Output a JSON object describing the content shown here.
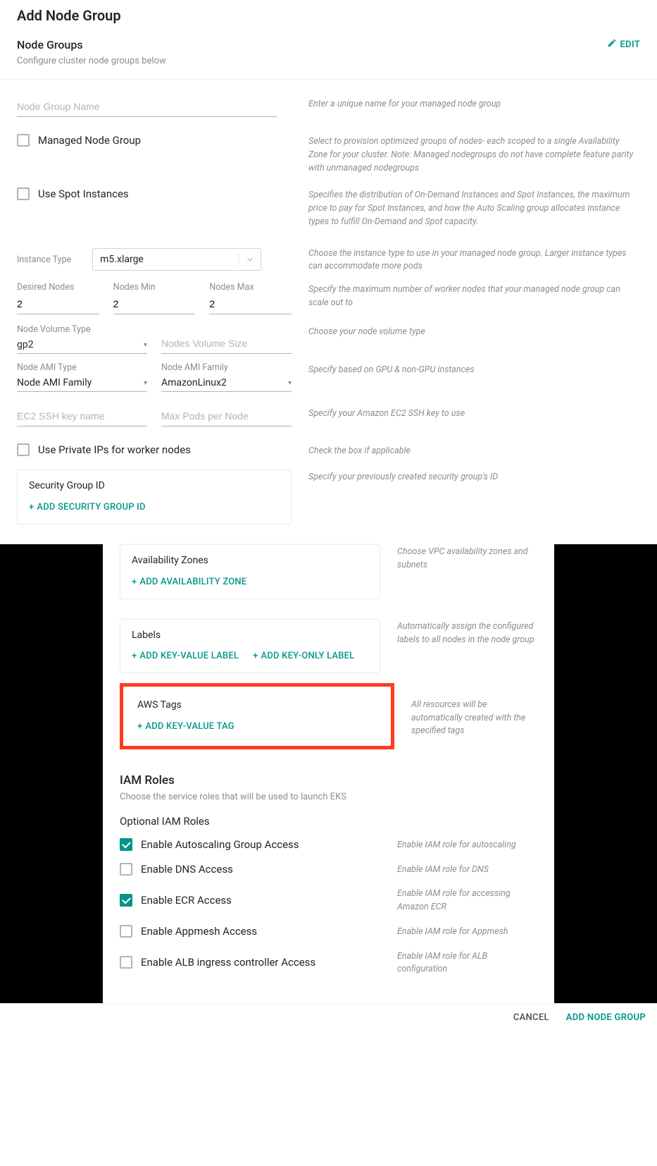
{
  "page_title": "Add Node Group",
  "edit_label": "EDIT",
  "node_groups": {
    "title": "Node Groups",
    "subtitle": "Configure cluster node groups below"
  },
  "fields": {
    "node_group_name": {
      "placeholder": "Node Group Name",
      "help": "Enter a unique name for your managed node group"
    },
    "managed": {
      "label": "Managed Node Group",
      "help": "Select to provision optimized groups of nodes- each scoped to a single Availability Zone for your cluster. Note: Managed nodegroups do not have complete feature parity with unmanaged nodegroups"
    },
    "spot": {
      "label": "Use Spot Instances",
      "help": "Specifies the distribution of On-Demand Instances and Spot Instances, the maximum price to pay for Spot Instances, and how the Auto Scaling group allocates instance types to fulfill On-Demand and Spot capacity."
    },
    "instance_type": {
      "label": "Instance Type",
      "value": "m5.xlarge",
      "help": "Choose the instance type to use in your managed node group. Larger instance types can accommodate more pods"
    },
    "desired_nodes": {
      "label": "Desired Nodes",
      "value": "2"
    },
    "nodes_min": {
      "label": "Nodes Min",
      "value": "2"
    },
    "nodes_max": {
      "label": "Nodes Max",
      "value": "2",
      "help": "Specify the maximum number of worker nodes that your managed node group can scale out to"
    },
    "node_volume_type": {
      "label": "Node Volume Type",
      "value": "gp2",
      "help": "Choose your node volume type"
    },
    "nodes_volume_size": {
      "placeholder": "Nodes Volume Size"
    },
    "node_ami_type": {
      "label": "Node AMI Type",
      "value": "Node AMI Family",
      "help": "Specify based on GPU & non-GPU instances"
    },
    "node_ami_family": {
      "label": "Node AMI Family",
      "value": "AmazonLinux2"
    },
    "ec2_ssh_key": {
      "placeholder": "EC2 SSH key name",
      "help": "Specify your Amazon EC2 SSH key to use"
    },
    "max_pods": {
      "placeholder": "Max Pods per Node"
    },
    "private_ips": {
      "label": "Use Private IPs for worker nodes",
      "help": "Check the box if applicable"
    },
    "security_group": {
      "title": "Security Group ID",
      "add_label": "ADD  SECURITY GROUP ID",
      "help": "Specify your previously created security group's ID"
    },
    "az": {
      "title": "Availability Zones",
      "add_label": "ADD  AVAILABILITY ZONE",
      "help": "Choose VPC availability zones and subnets"
    },
    "labels": {
      "title": "Labels",
      "add_kv": "ADD KEY-VALUE LABEL",
      "add_k": "ADD KEY-ONLY LABEL",
      "help": "Automatically assign the configured labels to all nodes in the node group"
    },
    "aws_tags": {
      "title": "AWS Tags",
      "add_label": "ADD KEY-VALUE TAG",
      "help": "All resources will be automatically created with the specified tags"
    }
  },
  "iam": {
    "title": "IAM Roles",
    "subtitle": "Choose the service roles that will be used to launch EKS",
    "optional_title": "Optional IAM Roles",
    "roles": [
      {
        "label": "Enable Autoscaling Group Access",
        "help": "Enable IAM role for autoscaling",
        "checked": true
      },
      {
        "label": "Enable DNS Access",
        "help": "Enable IAM role for DNS",
        "checked": false
      },
      {
        "label": "Enable ECR Access",
        "help": "Enable IAM role for accessing Amazon ECR",
        "checked": true
      },
      {
        "label": "Enable Appmesh Access",
        "help": "Enable IAM role for Appmesh",
        "checked": false
      },
      {
        "label": "Enable ALB ingress controller Access",
        "help": "Enable IAM role for ALB configuration",
        "checked": false
      }
    ]
  },
  "footer": {
    "cancel": "CANCEL",
    "primary": "ADD NODE GROUP"
  }
}
